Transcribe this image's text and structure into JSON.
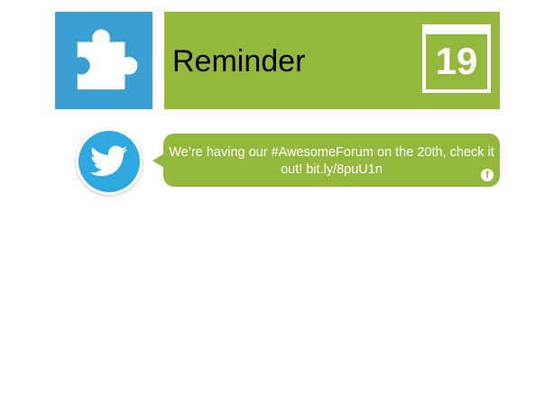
{
  "header": {
    "app_icon": "puzzle-piece-icon",
    "title": "Reminder",
    "calendar_day": "19"
  },
  "post": {
    "avatar_icon": "twitter-bird-icon",
    "message": "We’re having our #AwesomeForum on the 20th, check it out! bit.ly/8puU1n",
    "source_icon": "facebook-icon",
    "source_glyph": "f"
  },
  "colors": {
    "tile_blue": "#3b9fd1",
    "brand_green": "#94b83c",
    "twitter_blue": "#2fa8e0"
  }
}
